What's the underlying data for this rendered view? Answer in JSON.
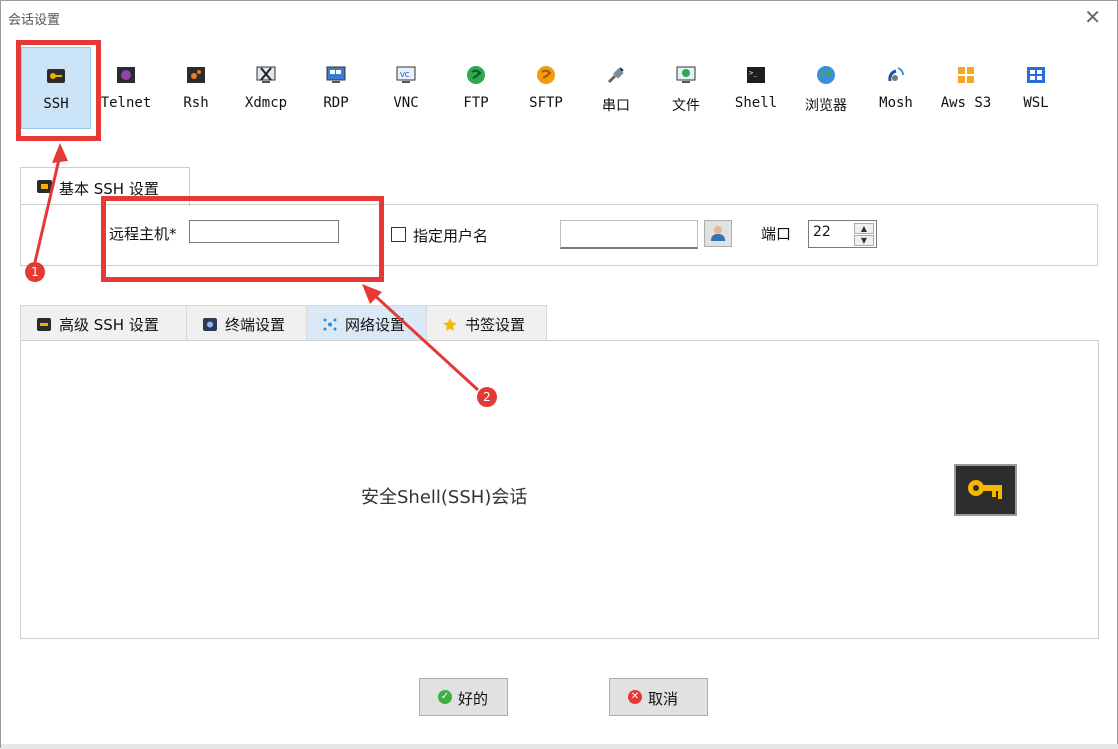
{
  "window": {
    "title": "会话设置"
  },
  "toolbar": {
    "items": [
      {
        "label": "SSH",
        "icon": "key-icon"
      },
      {
        "label": "Telnet",
        "icon": "telnet-icon"
      },
      {
        "label": "Rsh",
        "icon": "rsh-icon"
      },
      {
        "label": "Xdmcp",
        "icon": "xdmcp-icon"
      },
      {
        "label": "RDP",
        "icon": "rdp-icon"
      },
      {
        "label": "VNC",
        "icon": "vnc-icon"
      },
      {
        "label": "FTP",
        "icon": "ftp-icon"
      },
      {
        "label": "SFTP",
        "icon": "sftp-icon"
      },
      {
        "label": "串口",
        "icon": "serial-icon"
      },
      {
        "label": "文件",
        "icon": "file-icon"
      },
      {
        "label": "Shell",
        "icon": "shell-icon"
      },
      {
        "label": "浏览器",
        "icon": "browser-icon"
      },
      {
        "label": "Mosh",
        "icon": "mosh-icon"
      },
      {
        "label": "Aws S3",
        "icon": "aws-s3-icon"
      },
      {
        "label": "WSL",
        "icon": "wsl-icon"
      }
    ],
    "selected": "SSH"
  },
  "basic": {
    "tab_label": "基本 SSH 设置",
    "remote_host_label": "远程主机*",
    "remote_host_value": "",
    "specify_user_label": "指定用户名",
    "specify_user_checked": false,
    "username_value": "",
    "port_label": "端口",
    "port_value": "22"
  },
  "tabs": [
    {
      "label": "高级 SSH 设置",
      "icon": "key-icon"
    },
    {
      "label": "终端设置",
      "icon": "terminal-icon"
    },
    {
      "label": "网络设置",
      "icon": "network-icon"
    },
    {
      "label": "书签设置",
      "icon": "star-icon"
    }
  ],
  "active_tab": "网络设置",
  "content": {
    "description": "安全Shell(SSH)会话"
  },
  "buttons": {
    "ok": "好的",
    "cancel": "取消"
  },
  "annotations": {
    "marker1": "1",
    "marker2": "2"
  },
  "colors": {
    "annotation_red": "#e53935",
    "selection_blue": "#cce4f7"
  }
}
